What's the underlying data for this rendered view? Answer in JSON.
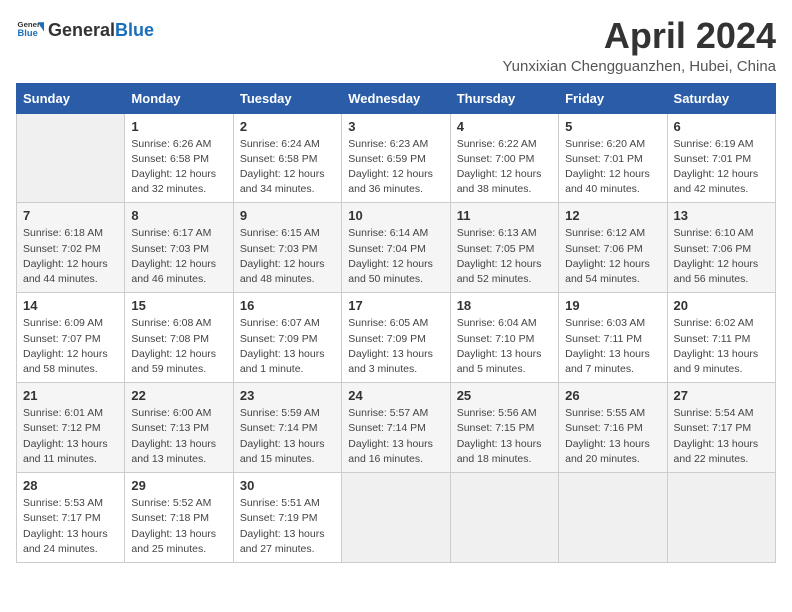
{
  "header": {
    "logo_general": "General",
    "logo_blue": "Blue",
    "title": "April 2024",
    "subtitle": "Yunxixian Chengguanzhen, Hubei, China"
  },
  "columns": [
    "Sunday",
    "Monday",
    "Tuesday",
    "Wednesday",
    "Thursday",
    "Friday",
    "Saturday"
  ],
  "weeks": [
    [
      {
        "date": "",
        "info": ""
      },
      {
        "date": "1",
        "info": "Sunrise: 6:26 AM\nSunset: 6:58 PM\nDaylight: 12 hours\nand 32 minutes."
      },
      {
        "date": "2",
        "info": "Sunrise: 6:24 AM\nSunset: 6:58 PM\nDaylight: 12 hours\nand 34 minutes."
      },
      {
        "date": "3",
        "info": "Sunrise: 6:23 AM\nSunset: 6:59 PM\nDaylight: 12 hours\nand 36 minutes."
      },
      {
        "date": "4",
        "info": "Sunrise: 6:22 AM\nSunset: 7:00 PM\nDaylight: 12 hours\nand 38 minutes."
      },
      {
        "date": "5",
        "info": "Sunrise: 6:20 AM\nSunset: 7:01 PM\nDaylight: 12 hours\nand 40 minutes."
      },
      {
        "date": "6",
        "info": "Sunrise: 6:19 AM\nSunset: 7:01 PM\nDaylight: 12 hours\nand 42 minutes."
      }
    ],
    [
      {
        "date": "7",
        "info": "Sunrise: 6:18 AM\nSunset: 7:02 PM\nDaylight: 12 hours\nand 44 minutes."
      },
      {
        "date": "8",
        "info": "Sunrise: 6:17 AM\nSunset: 7:03 PM\nDaylight: 12 hours\nand 46 minutes."
      },
      {
        "date": "9",
        "info": "Sunrise: 6:15 AM\nSunset: 7:03 PM\nDaylight: 12 hours\nand 48 minutes."
      },
      {
        "date": "10",
        "info": "Sunrise: 6:14 AM\nSunset: 7:04 PM\nDaylight: 12 hours\nand 50 minutes."
      },
      {
        "date": "11",
        "info": "Sunrise: 6:13 AM\nSunset: 7:05 PM\nDaylight: 12 hours\nand 52 minutes."
      },
      {
        "date": "12",
        "info": "Sunrise: 6:12 AM\nSunset: 7:06 PM\nDaylight: 12 hours\nand 54 minutes."
      },
      {
        "date": "13",
        "info": "Sunrise: 6:10 AM\nSunset: 7:06 PM\nDaylight: 12 hours\nand 56 minutes."
      }
    ],
    [
      {
        "date": "14",
        "info": "Sunrise: 6:09 AM\nSunset: 7:07 PM\nDaylight: 12 hours\nand 58 minutes."
      },
      {
        "date": "15",
        "info": "Sunrise: 6:08 AM\nSunset: 7:08 PM\nDaylight: 12 hours\nand 59 minutes."
      },
      {
        "date": "16",
        "info": "Sunrise: 6:07 AM\nSunset: 7:09 PM\nDaylight: 13 hours\nand 1 minute."
      },
      {
        "date": "17",
        "info": "Sunrise: 6:05 AM\nSunset: 7:09 PM\nDaylight: 13 hours\nand 3 minutes."
      },
      {
        "date": "18",
        "info": "Sunrise: 6:04 AM\nSunset: 7:10 PM\nDaylight: 13 hours\nand 5 minutes."
      },
      {
        "date": "19",
        "info": "Sunrise: 6:03 AM\nSunset: 7:11 PM\nDaylight: 13 hours\nand 7 minutes."
      },
      {
        "date": "20",
        "info": "Sunrise: 6:02 AM\nSunset: 7:11 PM\nDaylight: 13 hours\nand 9 minutes."
      }
    ],
    [
      {
        "date": "21",
        "info": "Sunrise: 6:01 AM\nSunset: 7:12 PM\nDaylight: 13 hours\nand 11 minutes."
      },
      {
        "date": "22",
        "info": "Sunrise: 6:00 AM\nSunset: 7:13 PM\nDaylight: 13 hours\nand 13 minutes."
      },
      {
        "date": "23",
        "info": "Sunrise: 5:59 AM\nSunset: 7:14 PM\nDaylight: 13 hours\nand 15 minutes."
      },
      {
        "date": "24",
        "info": "Sunrise: 5:57 AM\nSunset: 7:14 PM\nDaylight: 13 hours\nand 16 minutes."
      },
      {
        "date": "25",
        "info": "Sunrise: 5:56 AM\nSunset: 7:15 PM\nDaylight: 13 hours\nand 18 minutes."
      },
      {
        "date": "26",
        "info": "Sunrise: 5:55 AM\nSunset: 7:16 PM\nDaylight: 13 hours\nand 20 minutes."
      },
      {
        "date": "27",
        "info": "Sunrise: 5:54 AM\nSunset: 7:17 PM\nDaylight: 13 hours\nand 22 minutes."
      }
    ],
    [
      {
        "date": "28",
        "info": "Sunrise: 5:53 AM\nSunset: 7:17 PM\nDaylight: 13 hours\nand 24 minutes."
      },
      {
        "date": "29",
        "info": "Sunrise: 5:52 AM\nSunset: 7:18 PM\nDaylight: 13 hours\nand 25 minutes."
      },
      {
        "date": "30",
        "info": "Sunrise: 5:51 AM\nSunset: 7:19 PM\nDaylight: 13 hours\nand 27 minutes."
      },
      {
        "date": "",
        "info": ""
      },
      {
        "date": "",
        "info": ""
      },
      {
        "date": "",
        "info": ""
      },
      {
        "date": "",
        "info": ""
      }
    ]
  ]
}
